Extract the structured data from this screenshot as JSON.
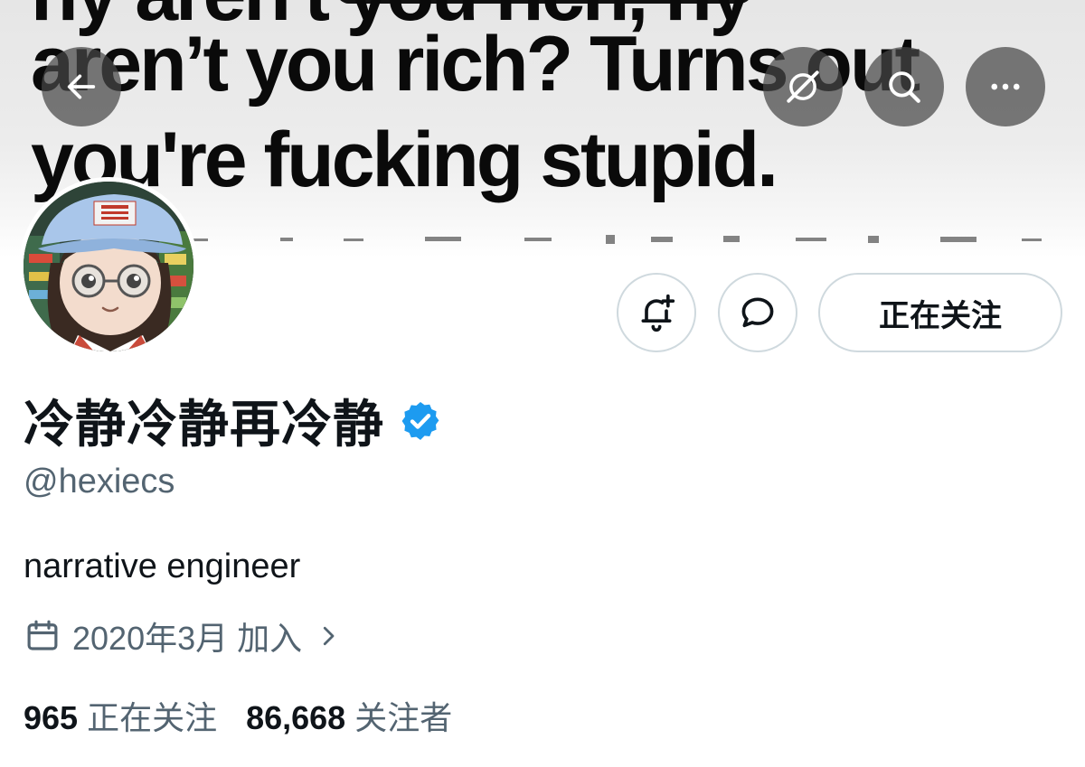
{
  "banner": {
    "text_top": "hy aren't you rich, hy",
    "text_line1": "aren’t you rich? Turns out",
    "text_line2": "you're fucking stupid."
  },
  "top_bar": {
    "back_icon": "arrow-left-icon",
    "grok_icon": "grok-icon",
    "search_icon": "search-icon",
    "more_icon": "more-horizontal-icon"
  },
  "actions": {
    "notify_icon": "bell-plus-icon",
    "message_icon": "chat-bubble-icon",
    "follow_label": "正在关注"
  },
  "profile": {
    "display_name": "冷静冷静再冷静",
    "verified": true,
    "handle": "@hexiecs",
    "bio": "narrative engineer",
    "joined": "2020年3月 加入",
    "following_count": "965",
    "following_label": "正在关注",
    "followers_count": "86,668",
    "followers_label": "关注者"
  },
  "colors": {
    "verified_blue": "#1d9bf0",
    "secondary_text": "#536471",
    "border": "#cfd9de"
  }
}
